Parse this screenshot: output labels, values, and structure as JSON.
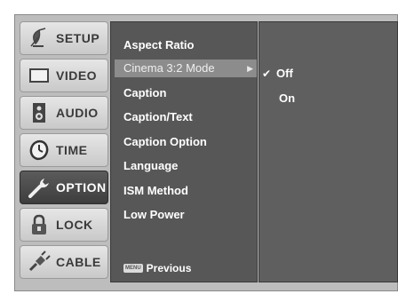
{
  "tabs": [
    {
      "label": "SETUP",
      "icon": "satellite-dish-icon",
      "active": false
    },
    {
      "label": "VIDEO",
      "icon": "monitor-icon",
      "active": false
    },
    {
      "label": "AUDIO",
      "icon": "speaker-icon",
      "active": false
    },
    {
      "label": "TIME",
      "icon": "clock-icon",
      "active": false
    },
    {
      "label": "OPTION",
      "icon": "wrench-icon",
      "active": true
    },
    {
      "label": "LOCK",
      "icon": "padlock-icon",
      "active": false
    },
    {
      "label": "CABLE",
      "icon": "plug-icon",
      "active": false
    }
  ],
  "menu": {
    "items": [
      "Aspect Ratio",
      "Cinema 3:2 Mode",
      "Caption",
      "Caption/Text",
      "Caption Option",
      "Language",
      "ISM Method",
      "Low Power"
    ],
    "selected_index": 1,
    "submenu_arrow": "▶",
    "footer_key": "MENU",
    "footer_label": "Previous"
  },
  "options": {
    "items": [
      "Off",
      "On"
    ],
    "checked_index": 0,
    "check_glyph": "✔"
  },
  "colors": {
    "menu_bg": "#575757",
    "selected_bg": "#8c8c8c",
    "active_tab_bg": "#4a4a4a",
    "tab_bg": "#d6d6d6"
  }
}
